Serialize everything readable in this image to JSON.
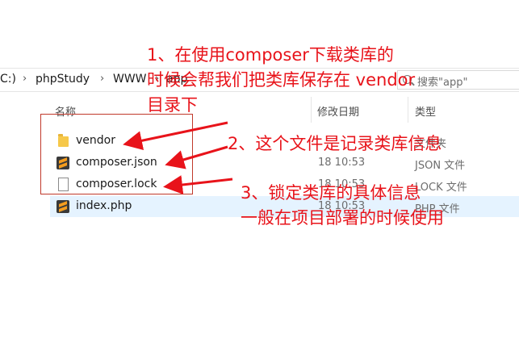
{
  "address_bar": {
    "drive": "C:)",
    "crumbs": [
      "phpStudy",
      "WWW",
      "app"
    ],
    "search_placeholder": "搜索\"app\""
  },
  "columns": {
    "name": "名称",
    "date": "修改日期",
    "type": "类型"
  },
  "files": [
    {
      "name": "vendor",
      "date": "",
      "type": "文件夹",
      "icon": "folder-icon"
    },
    {
      "name": "composer.json",
      "date": "18 10:53",
      "type": "JSON 文件",
      "icon": "sublime-icon"
    },
    {
      "name": "composer.lock",
      "date": "18 10:53",
      "type": "LOCK 文件",
      "icon": "file-icon"
    },
    {
      "name": "index.php",
      "date": "18 10:53",
      "type": "PHP 文件",
      "icon": "sublime-icon"
    }
  ],
  "annotations": {
    "a1_line1": "1、在使用composer下载类库的",
    "a1_line2": "时候会帮我们把类库保存在 vendor",
    "a1_line3": "目录下",
    "a2": "2、这个文件是记录类库信息",
    "a3_line1": "3、锁定类库的具体信息",
    "a3_line2": "一般在项目部署的时候使用"
  },
  "colors": {
    "annotation": "#e8131a",
    "selected_row": "#e5f3ff"
  }
}
